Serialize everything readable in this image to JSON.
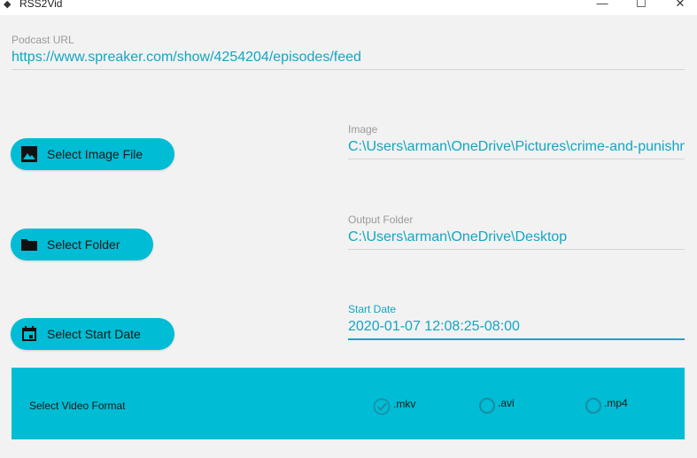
{
  "window": {
    "title": "RSS2Vid",
    "minimize_glyph": "—",
    "maximize_glyph": "☐",
    "close_glyph": "✕"
  },
  "podcast_url": {
    "label": "Podcast URL",
    "value": "https://www.spreaker.com/show/4254204/episodes/feed"
  },
  "image": {
    "button_label": "Select Image File",
    "button_icon": "image-icon",
    "field_label": "Image",
    "field_value": "C:\\Users\\arman\\OneDrive\\Pictures\\crime-and-punishment"
  },
  "folder": {
    "button_label": "Select Folder",
    "button_icon": "folder-icon",
    "field_label": "Output Folder",
    "field_value": "C:\\Users\\arman\\OneDrive\\Desktop"
  },
  "start_date": {
    "button_label": "Select Start Date",
    "button_icon": "calendar-icon",
    "field_label": "Start Date",
    "field_value": "2020-01-07 12:08:25-08:00"
  },
  "video_format": {
    "title": "Select Video Format",
    "options": [
      {
        "label": ".mkv",
        "selected": true
      },
      {
        "label": ".avi",
        "selected": false
      },
      {
        "label": ".mp4",
        "selected": false
      }
    ]
  },
  "colors": {
    "accent": "#00bcd4",
    "text_accent": "#12a6c2",
    "background": "#f2f2f2"
  }
}
